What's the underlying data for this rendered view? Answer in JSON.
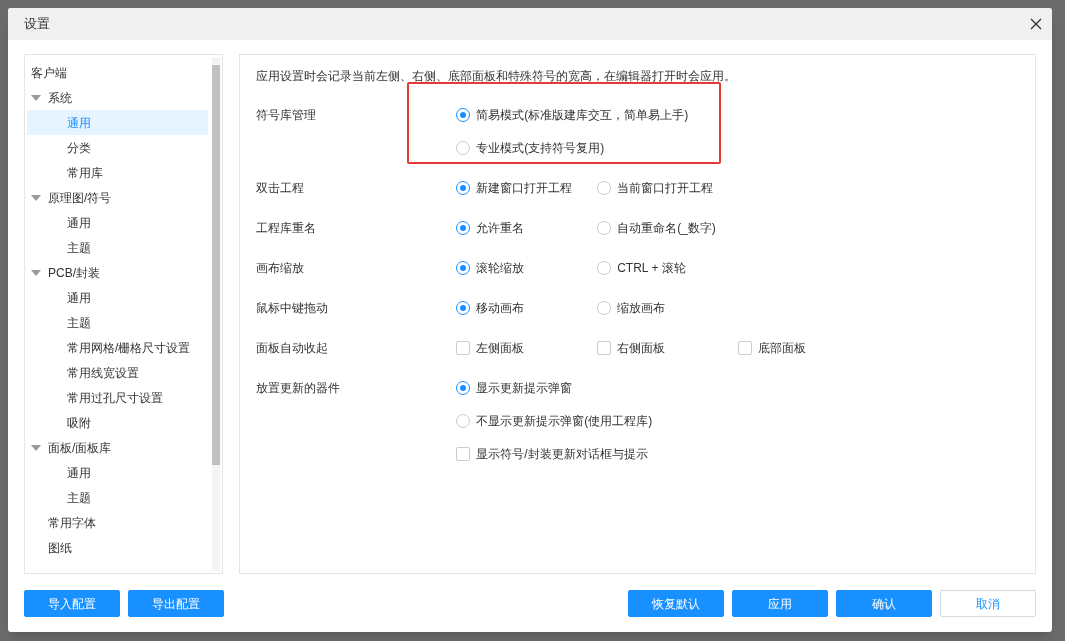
{
  "window": {
    "title": "设置"
  },
  "sidebar": {
    "items": [
      {
        "label": "客户端",
        "selected": false,
        "children": [
          {
            "label": "系统",
            "expanded": true,
            "selected": false,
            "children": [
              {
                "label": "通用",
                "selected": true
              },
              {
                "label": "分类",
                "selected": false
              },
              {
                "label": "常用库",
                "selected": false
              }
            ]
          },
          {
            "label": "原理图/符号",
            "expanded": true,
            "selected": false,
            "children": [
              {
                "label": "通用",
                "selected": false
              },
              {
                "label": "主题",
                "selected": false
              }
            ]
          },
          {
            "label": "PCB/封装",
            "expanded": true,
            "selected": false,
            "children": [
              {
                "label": "通用",
                "selected": false
              },
              {
                "label": "主题",
                "selected": false
              },
              {
                "label": "常用网格/栅格尺寸设置",
                "selected": false
              },
              {
                "label": "常用线宽设置",
                "selected": false
              },
              {
                "label": "常用过孔尺寸设置",
                "selected": false
              },
              {
                "label": "吸附",
                "selected": false
              }
            ]
          },
          {
            "label": "面板/面板库",
            "expanded": true,
            "selected": false,
            "children": [
              {
                "label": "通用",
                "selected": false
              },
              {
                "label": "主题",
                "selected": false
              }
            ]
          },
          {
            "label": "常用字体",
            "selected": false
          },
          {
            "label": "图纸",
            "selected": false
          }
        ]
      }
    ]
  },
  "content": {
    "note": "应用设置时会记录当前左侧、右侧、底部面板和特殊符号的宽高，在编辑器打开时会应用。",
    "settings": [
      {
        "label": "符号库管理",
        "stacked": true,
        "highlighted": true,
        "options": [
          {
            "kind": "radio",
            "label": "简易模式(标准版建库交互，简单易上手)",
            "selected": true
          },
          {
            "kind": "radio",
            "label": "专业模式(支持符号复用)",
            "selected": false
          }
        ]
      },
      {
        "label": "双击工程",
        "stacked": false,
        "options": [
          {
            "kind": "radio",
            "label": "新建窗口打开工程",
            "selected": true
          },
          {
            "kind": "radio",
            "label": "当前窗口打开工程",
            "selected": false
          }
        ]
      },
      {
        "label": "工程库重名",
        "stacked": false,
        "options": [
          {
            "kind": "radio",
            "label": "允许重名",
            "selected": true
          },
          {
            "kind": "radio",
            "label": "自动重命名(_数字)",
            "selected": false
          }
        ]
      },
      {
        "label": "画布缩放",
        "stacked": false,
        "options": [
          {
            "kind": "radio",
            "label": "滚轮缩放",
            "selected": true
          },
          {
            "kind": "radio",
            "label": "CTRL + 滚轮",
            "selected": false
          }
        ]
      },
      {
        "label": "鼠标中键拖动",
        "stacked": false,
        "options": [
          {
            "kind": "radio",
            "label": "移动画布",
            "selected": true
          },
          {
            "kind": "radio",
            "label": "缩放画布",
            "selected": false
          }
        ]
      },
      {
        "label": "面板自动收起",
        "stacked": false,
        "options": [
          {
            "kind": "checkbox",
            "label": "左侧面板",
            "checked": false
          },
          {
            "kind": "checkbox",
            "label": "右侧面板",
            "checked": false
          },
          {
            "kind": "checkbox",
            "label": "底部面板",
            "checked": false
          }
        ]
      },
      {
        "label": "放置更新的器件",
        "stacked": true,
        "options": [
          {
            "kind": "radio",
            "label": "显示更新提示弹窗",
            "selected": true
          },
          {
            "kind": "radio",
            "label": "不显示更新提示弹窗(使用工程库)",
            "selected": false
          },
          {
            "kind": "checkbox",
            "label": "显示符号/封装更新对话框与提示",
            "checked": false
          }
        ]
      }
    ]
  },
  "footer": {
    "left_buttons": [
      {
        "label": "导入配置",
        "kind": "primary"
      },
      {
        "label": "导出配置",
        "kind": "primary"
      }
    ],
    "right_buttons": [
      {
        "label": "恢复默认",
        "kind": "primary"
      },
      {
        "label": "应用",
        "kind": "primary"
      },
      {
        "label": "确认",
        "kind": "primary"
      },
      {
        "label": "取消",
        "kind": "default"
      }
    ]
  }
}
